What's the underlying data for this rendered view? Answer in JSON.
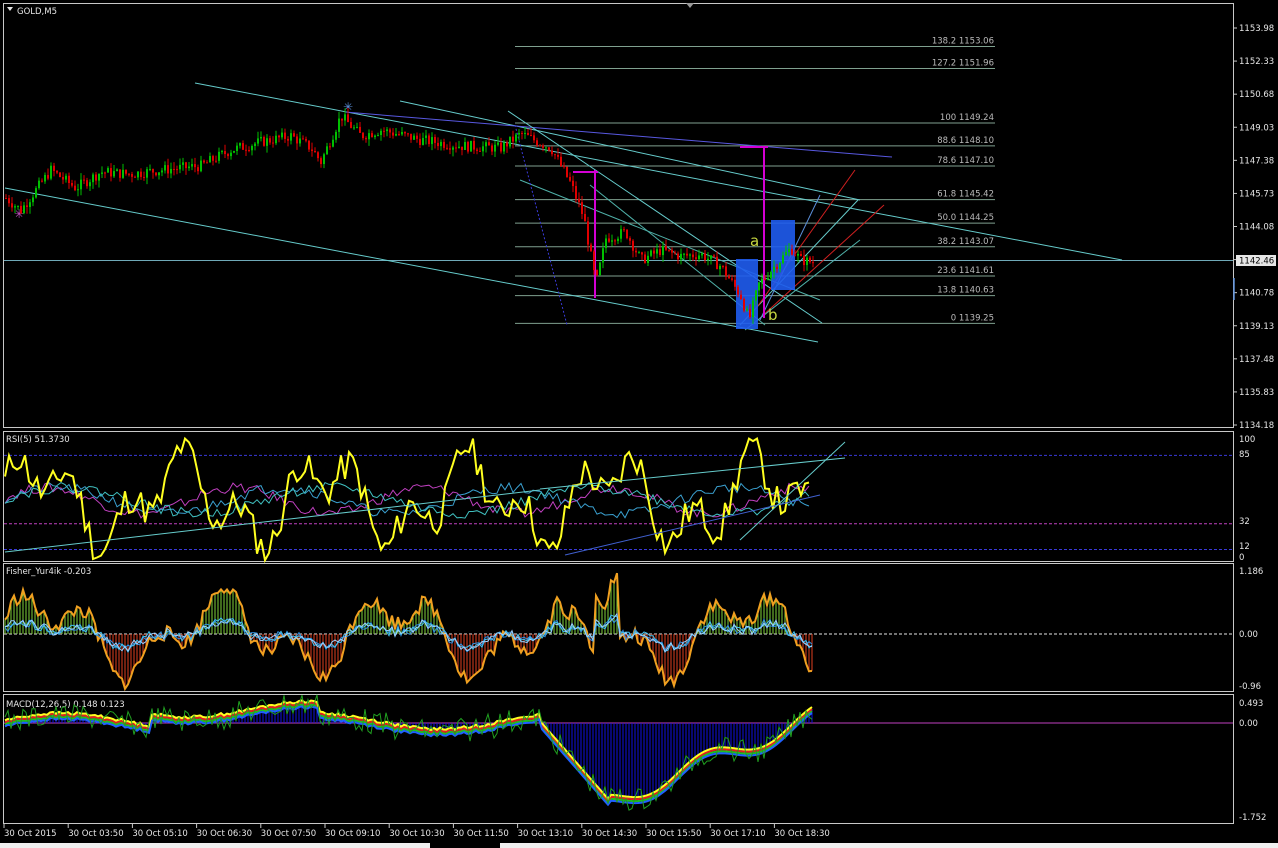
{
  "colors": {
    "background": "#000000",
    "frame": "#c8c8c8",
    "bull": "#00c000",
    "bear": "#e00000",
    "fib": "#7fa08f",
    "channel": "#66cccc",
    "blue_line": "#5858e0",
    "magenta": "#d400d4",
    "rsi_main": "#ffff20",
    "macd_hist": "#1010e0"
  },
  "main": {
    "title": "GOLD,M5",
    "price_ticks": [
      "1153.98",
      "1152.33",
      "1150.68",
      "1149.03",
      "1147.38",
      "1145.73",
      "1144.08",
      "1142.43",
      "1140.78",
      "1139.13",
      "1137.48",
      "1135.83",
      "1134.18"
    ],
    "current_price": "1142.46",
    "fib_levels": [
      {
        "ratio": "138.2",
        "price": "1153.06"
      },
      {
        "ratio": "127.2",
        "price": "1151.96"
      },
      {
        "ratio": "100",
        "price": "1149.24"
      },
      {
        "ratio": "88.6",
        "price": "1148.10"
      },
      {
        "ratio": "78.6",
        "price": "1147.10"
      },
      {
        "ratio": "61.8",
        "price": "1145.42"
      },
      {
        "ratio": "50.0",
        "price": "1144.25"
      },
      {
        "ratio": "38.2",
        "price": "1143.07"
      },
      {
        "ratio": "23.6",
        "price": "1141.61"
      },
      {
        "ratio": "13.8",
        "price": "1140.63"
      },
      {
        "ratio": "0",
        "price": "1139.25"
      }
    ],
    "wave_labels": [
      "a",
      "b"
    ]
  },
  "rsi": {
    "label": "RSI(5) 51.3730",
    "ticks": [
      "100",
      "85",
      "32",
      "12",
      "0"
    ]
  },
  "fisher": {
    "label": "Fisher_Yur4ik -0.203",
    "ticks": [
      "1.186",
      "0.00",
      "-0.96"
    ]
  },
  "macd": {
    "label": "MACD(12,26,5) 0.148 0.123",
    "ticks": [
      "0.493",
      "0.00",
      "-1.752"
    ]
  },
  "time_axis": [
    "30 Oct 2015",
    "30 Oct 03:50",
    "30 Oct 05:10",
    "30 Oct 06:30",
    "30 Oct 07:50",
    "30 Oct 09:10",
    "30 Oct 10:30",
    "30 Oct 11:50",
    "30 Oct 13:10",
    "30 Oct 14:30",
    "30 Oct 15:50",
    "30 Oct 17:10",
    "30 Oct 18:30"
  ],
  "chart_data": {
    "type": "candlestick",
    "symbol": "GOLD",
    "timeframe": "M5",
    "title": "GOLD,M5",
    "ylim": [
      1134.18,
      1153.98
    ],
    "last_price": 1142.46,
    "approx_close_path": [
      {
        "x": "30 Oct 2015",
        "y": 1145.0
      },
      {
        "x": "30 Oct 03:50",
        "y": 1146.7
      },
      {
        "x": "30 Oct 05:10",
        "y": 1147.0
      },
      {
        "x": "30 Oct 06:30",
        "y": 1147.9
      },
      {
        "x": "30 Oct 07:50",
        "y": 1148.6
      },
      {
        "x": "30 Oct 09:10",
        "y": 1149.5
      },
      {
        "x": "30 Oct 10:30",
        "y": 1148.6
      },
      {
        "x": "30 Oct 11:50",
        "y": 1148.3
      },
      {
        "x": "30 Oct 13:10",
        "y": 1148.7
      },
      {
        "x": "30 Oct 14:30",
        "y": 1143.6
      },
      {
        "x": "30 Oct 15:50",
        "y": 1142.4
      },
      {
        "x": "30 Oct 17:10",
        "y": 1139.3
      },
      {
        "x": "30 Oct 18:30",
        "y": 1143.5
      }
    ],
    "indicators": [
      "RSI(5) 51.3730",
      "Fisher_Yur4ik -0.203",
      "MACD(12,26,5) 0.148 0.123"
    ]
  }
}
